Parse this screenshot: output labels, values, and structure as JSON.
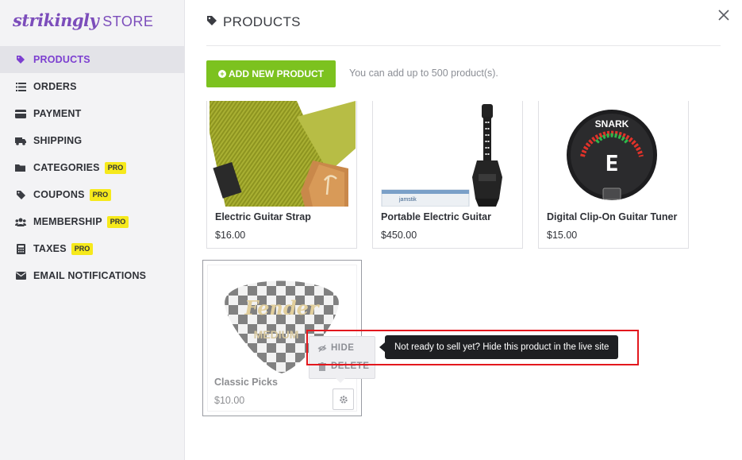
{
  "brand": {
    "logo": "strikingly",
    "store": "STORE",
    "color": "#7c4dbb"
  },
  "sidebar": {
    "items": [
      {
        "label": "PRODUCTS",
        "icon": "tag-icon",
        "active": true
      },
      {
        "label": "ORDERS",
        "icon": "list-icon"
      },
      {
        "label": "PAYMENT",
        "icon": "credit-card-icon"
      },
      {
        "label": "SHIPPING",
        "icon": "truck-icon"
      },
      {
        "label": "CATEGORIES",
        "icon": "folder-icon",
        "badge": "PRO"
      },
      {
        "label": "COUPONS",
        "icon": "tag-icon",
        "badge": "PRO"
      },
      {
        "label": "MEMBERSHIP",
        "icon": "users-icon",
        "badge": "PRO"
      },
      {
        "label": "TAXES",
        "icon": "calculator-icon",
        "badge": "PRO"
      },
      {
        "label": "EMAIL NOTIFICATIONS",
        "icon": "envelope-icon"
      }
    ]
  },
  "header": {
    "title": "PRODUCTS",
    "icon": "tag-icon"
  },
  "toolbar": {
    "add_label": "ADD NEW PRODUCT",
    "hint": "You can add up to 500 product(s).",
    "add_color": "#7cc21f"
  },
  "products": [
    {
      "name": "Electric Guitar Strap",
      "price": "$16.00"
    },
    {
      "name": "Portable Electric Guitar",
      "price": "$450.00"
    },
    {
      "name": "Digital Clip-On Guitar Tuner",
      "price": "$15.00"
    },
    {
      "name": "Classic Picks",
      "price": "$10.00"
    }
  ],
  "product_images": {
    "tuner_brand": "SNARK",
    "tuner_note": "E",
    "guitar_box_label": "jamstik",
    "pick_brand": "Fender",
    "pick_size": "MEDIUM"
  },
  "menu": {
    "hide_label": "HIDE",
    "delete_label": "DELETE"
  },
  "tooltip": {
    "text": "Not ready to sell yet? Hide this product in the live site"
  },
  "colors": {
    "accent": "#7c3fd0",
    "pro_badge": "#f6e91b",
    "highlight": "#e3171d"
  }
}
